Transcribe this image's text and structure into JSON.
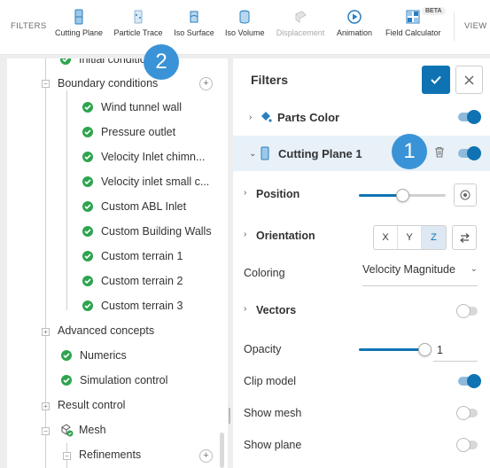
{
  "toolbar": {
    "filters_label": "FILTERS",
    "view_label": "VIEW",
    "beta_label": "BETA",
    "items": [
      {
        "label": "Cutting Plane",
        "icon": "cutting-plane-icon"
      },
      {
        "label": "Particle Trace",
        "icon": "particle-trace-icon"
      },
      {
        "label": "Iso Surface",
        "icon": "iso-surface-icon"
      },
      {
        "label": "Iso Volume",
        "icon": "iso-volume-icon"
      },
      {
        "label": "Displacement",
        "icon": "displacement-icon"
      },
      {
        "label": "Animation",
        "icon": "animation-icon"
      },
      {
        "label": "Field Calculator",
        "icon": "field-calculator-icon"
      }
    ]
  },
  "tree": {
    "initial_conditions": "Initial conditions",
    "boundary_conditions": "Boundary conditions",
    "boundary_items": [
      "Wind tunnel wall",
      "Pressure outlet",
      "Velocity Inlet chimn...",
      "Velocity inlet small c...",
      "Custom ABL Inlet",
      "Custom Building Walls",
      "Custom terrain 1",
      "Custom terrain 2",
      "Custom terrain 3"
    ],
    "advanced_concepts": "Advanced concepts",
    "numerics": "Numerics",
    "simulation_control": "Simulation control",
    "result_control": "Result control",
    "mesh": "Mesh",
    "refinements": "Refinements"
  },
  "filters_panel": {
    "title": "Filters",
    "parts_color": "Parts Color",
    "cutting_plane": "Cutting Plane 1",
    "position": "Position",
    "orientation": "Orientation",
    "axes": [
      "X",
      "Y",
      "Z"
    ],
    "active_axis": "Z",
    "coloring_label": "Coloring",
    "coloring_value": "Velocity Magnitude",
    "vectors": "Vectors",
    "opacity_label": "Opacity",
    "opacity_value": "1",
    "opacity_level": 1.0,
    "position_level": 0.5,
    "clip_model": "Clip model",
    "show_mesh": "Show mesh",
    "show_plane": "Show plane",
    "toggles": {
      "parts_color": true,
      "cutting_plane": true,
      "vectors": false,
      "clip_model": true,
      "show_mesh": false,
      "show_plane": false
    }
  },
  "badges": {
    "one": "1",
    "two": "2"
  },
  "colors": {
    "accent": "#0f73b3",
    "check": "#2ea44f",
    "badge": "#3a93d6"
  }
}
